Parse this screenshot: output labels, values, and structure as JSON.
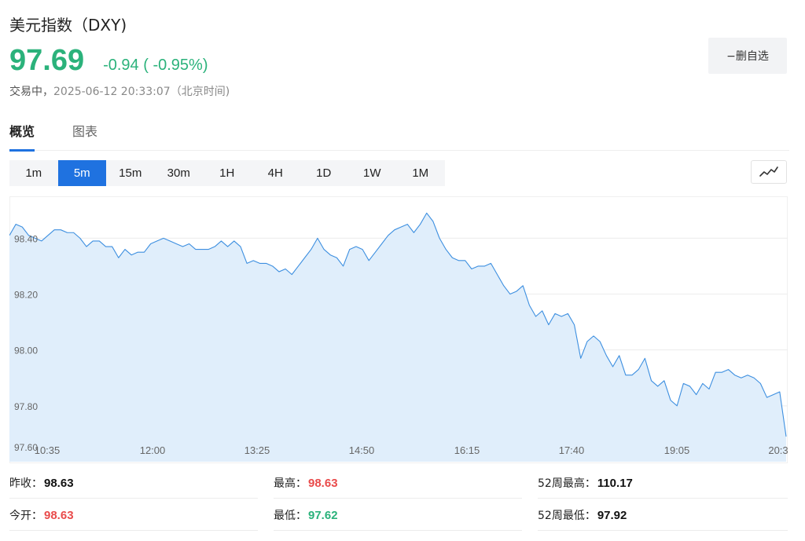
{
  "header": {
    "title": "美元指数（DXY)",
    "price": "97.69",
    "change": "-0.94 ( -0.95%)",
    "status_label": "交易中，",
    "timestamp": "2025-06-12 20:33:07（北京时间)"
  },
  "watch_button": {
    "label": "−删自选"
  },
  "tabs": [
    {
      "label": "概览",
      "active": true
    },
    {
      "label": "图表",
      "active": false
    }
  ],
  "intervals": [
    {
      "label": "1m",
      "active": false
    },
    {
      "label": "5m",
      "active": true
    },
    {
      "label": "15m",
      "active": false
    },
    {
      "label": "30m",
      "active": false
    },
    {
      "label": "1H",
      "active": false
    },
    {
      "label": "4H",
      "active": false
    },
    {
      "label": "1D",
      "active": false
    },
    {
      "label": "1W",
      "active": false
    },
    {
      "label": "1M",
      "active": false
    }
  ],
  "chart_type_icon": "line-chart-icon",
  "colors": {
    "up": "#e94b4b",
    "down": "#2bb27b",
    "accent": "#1f72e0",
    "line": "#3d8fe0",
    "area": "#e0eefb"
  },
  "chart_data": {
    "type": "area",
    "ylim": [
      97.6,
      98.55
    ],
    "y_ticks": [
      "97.60",
      "97.80",
      "98.00",
      "98.20",
      "98.40"
    ],
    "x_tick_labels": [
      "10:35",
      "12:00",
      "13:25",
      "14:50",
      "16:15",
      "17:40",
      "19:05",
      "20:3"
    ],
    "grid": true,
    "values": [
      98.41,
      98.45,
      98.44,
      98.41,
      98.4,
      98.39,
      98.41,
      98.43,
      98.43,
      98.42,
      98.42,
      98.4,
      98.37,
      98.39,
      98.39,
      98.37,
      98.37,
      98.33,
      98.36,
      98.34,
      98.35,
      98.35,
      98.38,
      98.39,
      98.4,
      98.39,
      98.38,
      98.37,
      98.38,
      98.36,
      98.36,
      98.36,
      98.37,
      98.39,
      98.37,
      98.39,
      98.37,
      98.31,
      98.32,
      98.31,
      98.31,
      98.3,
      98.28,
      98.29,
      98.27,
      98.3,
      98.33,
      98.36,
      98.4,
      98.36,
      98.34,
      98.33,
      98.3,
      98.36,
      98.37,
      98.36,
      98.32,
      98.35,
      98.38,
      98.41,
      98.43,
      98.44,
      98.45,
      98.42,
      98.45,
      98.49,
      98.46,
      98.4,
      98.36,
      98.33,
      98.32,
      98.32,
      98.29,
      98.3,
      98.3,
      98.31,
      98.27,
      98.23,
      98.2,
      98.21,
      98.23,
      98.16,
      98.12,
      98.14,
      98.09,
      98.13,
      98.12,
      98.13,
      98.09,
      97.97,
      98.03,
      98.05,
      98.03,
      97.98,
      97.94,
      97.98,
      97.91,
      97.91,
      97.93,
      97.97,
      97.89,
      97.87,
      97.89,
      97.82,
      97.8,
      97.88,
      97.87,
      97.84,
      97.88,
      97.86,
      97.92,
      97.92,
      97.93,
      97.91,
      97.9,
      97.91,
      97.9,
      97.88,
      97.83,
      97.84,
      97.85,
      97.69
    ]
  },
  "stats": [
    {
      "label": "昨收：",
      "value": "98.63",
      "tone": "neutral"
    },
    {
      "label": "最高：",
      "value": "98.63",
      "tone": "up"
    },
    {
      "label": "52周最高：",
      "value": "110.17",
      "tone": "neutral"
    },
    {
      "label": "今开：",
      "value": "98.63",
      "tone": "up"
    },
    {
      "label": "最低：",
      "value": "97.62",
      "tone": "down"
    },
    {
      "label": "52周最低：",
      "value": "97.92",
      "tone": "neutral"
    }
  ]
}
